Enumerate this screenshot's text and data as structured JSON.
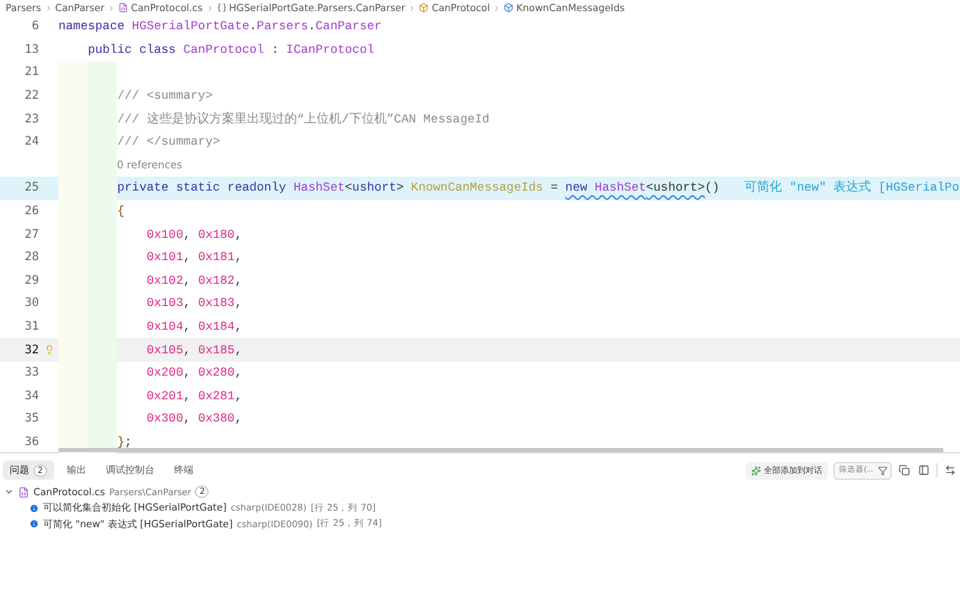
{
  "breadcrumb": [
    {
      "kind": "folder",
      "label": "Parsers"
    },
    {
      "kind": "folder",
      "label": "CanParser"
    },
    {
      "kind": "file",
      "label": "CanProtocol.cs"
    },
    {
      "kind": "namespace",
      "label": "HGSerialPortGate.Parsers.CanParser"
    },
    {
      "kind": "class",
      "label": "CanProtocol"
    },
    {
      "kind": "field",
      "label": "KnownCanMessageIds"
    }
  ],
  "editor": {
    "lines": [
      {
        "number": "6",
        "sticky": true,
        "tokens": [
          {
            "kind": "keyword",
            "text": "namespace "
          },
          {
            "kind": "type",
            "text": "HGSerialPortGate"
          },
          {
            "kind": "punct",
            "text": "."
          },
          {
            "kind": "type",
            "text": "Parsers"
          },
          {
            "kind": "punct",
            "text": "."
          },
          {
            "kind": "type",
            "text": "CanParser"
          }
        ]
      },
      {
        "number": "13",
        "sticky": true,
        "tokens": [
          {
            "kind": "keyword",
            "text": "    public class "
          },
          {
            "kind": "type",
            "text": "CanProtocol"
          },
          {
            "kind": "punct",
            "text": " : "
          },
          {
            "kind": "type",
            "text": "ICanProtocol"
          }
        ]
      },
      {
        "number": "21",
        "sticky": false
      },
      {
        "number": "22",
        "sticky": false,
        "tokens": [
          {
            "kind": "comment",
            "text": "        /// <summary>"
          }
        ]
      },
      {
        "number": "23",
        "sticky": false,
        "tokens": [
          {
            "kind": "comment",
            "text": "        /// 这些是协议方案里出现过的“上位机/下位机”CAN MessageId"
          }
        ]
      },
      {
        "number": "24",
        "sticky": false,
        "tokens": [
          {
            "kind": "comment",
            "text": "        /// </summary>"
          }
        ]
      },
      {
        "number": "25",
        "sticky": false,
        "codelens": "0 references",
        "highlight": true,
        "hint": "可简化 \"new\" 表达式 [HGSerialPo",
        "tokens": [
          {
            "kind": "keyword",
            "text": "        private static readonly "
          },
          {
            "kind": "type",
            "text": "HashSet"
          },
          {
            "kind": "punct",
            "text": "<"
          },
          {
            "kind": "keyword",
            "text": "ushort"
          },
          {
            "kind": "punct",
            "text": "> "
          },
          {
            "kind": "field",
            "text": "KnownCanMessageIds"
          },
          {
            "kind": "punct",
            "text": " = "
          },
          {
            "kind": "keyword",
            "text": "new ",
            "squiggle": true
          },
          {
            "kind": "type",
            "text": "HashSet",
            "squiggle": true
          },
          {
            "kind": "punct",
            "text": "<ushort>",
            "squiggle": true
          },
          {
            "kind": "punct",
            "text": "()"
          }
        ]
      },
      {
        "number": "26",
        "sticky": false,
        "tokens": [
          {
            "kind": "brace",
            "text": "        {"
          }
        ]
      },
      {
        "number": "27",
        "sticky": false,
        "tokens": [
          {
            "kind": "number",
            "text": "            0x100"
          },
          {
            "kind": "punct",
            "text": ", "
          },
          {
            "kind": "number",
            "text": "0x180"
          },
          {
            "kind": "punct",
            "text": ","
          }
        ]
      },
      {
        "number": "28",
        "sticky": false,
        "tokens": [
          {
            "kind": "number",
            "text": "            0x101"
          },
          {
            "kind": "punct",
            "text": ", "
          },
          {
            "kind": "number",
            "text": "0x181"
          },
          {
            "kind": "punct",
            "text": ","
          }
        ]
      },
      {
        "number": "29",
        "sticky": false,
        "tokens": [
          {
            "kind": "number",
            "text": "            0x102"
          },
          {
            "kind": "punct",
            "text": ", "
          },
          {
            "kind": "number",
            "text": "0x182"
          },
          {
            "kind": "punct",
            "text": ","
          }
        ]
      },
      {
        "number": "30",
        "sticky": false,
        "tokens": [
          {
            "kind": "number",
            "text": "            0x103"
          },
          {
            "kind": "punct",
            "text": ", "
          },
          {
            "kind": "number",
            "text": "0x183"
          },
          {
            "kind": "punct",
            "text": ","
          }
        ]
      },
      {
        "number": "31",
        "sticky": false,
        "tokens": [
          {
            "kind": "number",
            "text": "            0x104"
          },
          {
            "kind": "punct",
            "text": ", "
          },
          {
            "kind": "number",
            "text": "0x184"
          },
          {
            "kind": "punct",
            "text": ","
          }
        ]
      },
      {
        "number": "32",
        "sticky": false,
        "cursor": true,
        "lightbulb": true,
        "tokens": [
          {
            "kind": "number",
            "text": "            0x105"
          },
          {
            "kind": "punct",
            "text": ", "
          },
          {
            "kind": "number",
            "text": "0x185"
          },
          {
            "kind": "punct",
            "text": ","
          }
        ]
      },
      {
        "number": "33",
        "sticky": false,
        "tokens": [
          {
            "kind": "number",
            "text": "            0x200"
          },
          {
            "kind": "punct",
            "text": ", "
          },
          {
            "kind": "number",
            "text": "0x280"
          },
          {
            "kind": "punct",
            "text": ","
          }
        ]
      },
      {
        "number": "34",
        "sticky": false,
        "tokens": [
          {
            "kind": "number",
            "text": "            0x201"
          },
          {
            "kind": "punct",
            "text": ", "
          },
          {
            "kind": "number",
            "text": "0x281"
          },
          {
            "kind": "punct",
            "text": ","
          }
        ]
      },
      {
        "number": "35",
        "sticky": false,
        "tokens": [
          {
            "kind": "number",
            "text": "            0x300"
          },
          {
            "kind": "punct",
            "text": ", "
          },
          {
            "kind": "number",
            "text": "0x380"
          },
          {
            "kind": "punct",
            "text": ","
          }
        ]
      },
      {
        "number": "36",
        "sticky": false,
        "tokens": [
          {
            "kind": "brace",
            "text": "        }"
          },
          {
            "kind": "punct",
            "text": ";"
          }
        ]
      }
    ]
  },
  "panel": {
    "tabs": [
      {
        "label": "问题",
        "badge": "2",
        "selected": true
      },
      {
        "label": "输出",
        "selected": false
      },
      {
        "label": "调试控制台",
        "selected": false
      },
      {
        "label": "终端",
        "selected": false
      }
    ],
    "add_all_button": "全部添加到对话",
    "filter": {
      "placeholder": "筛选器(..."
    },
    "problems": {
      "file": "CanProtocol.cs",
      "path": "Parsers\\CanParser",
      "count": "2",
      "expanded": true,
      "items": [
        {
          "message": "可以简化集合初始化 [HGSerialPortGate]",
          "source": "csharp(IDE0028)",
          "location": "[行 25，列 70]"
        },
        {
          "message": "可简化 \"new\" 表达式 [HGSerialPortGate]",
          "source": "csharp(IDE0090)",
          "location": "[行 25，列 74]"
        }
      ]
    }
  }
}
